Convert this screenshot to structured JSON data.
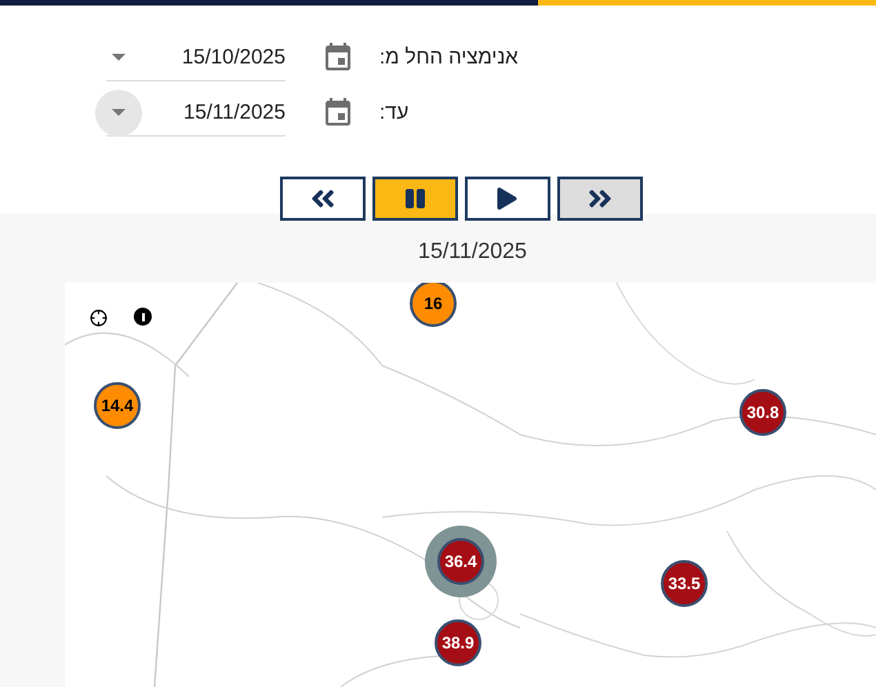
{
  "date_range": [
    {
      "label": "אנימציה החל מ:",
      "value": "15/10/2025",
      "highlighted": false
    },
    {
      "label": "עד:",
      "value": "15/11/2025",
      "highlighted": true
    }
  ],
  "playback_buttons": [
    {
      "kind": "rewind",
      "active": false,
      "pressed": false
    },
    {
      "kind": "pause",
      "active": true,
      "pressed": false
    },
    {
      "kind": "play",
      "active": false,
      "pressed": false
    },
    {
      "kind": "forward",
      "active": false,
      "pressed": true
    }
  ],
  "current_date": "15/11/2025",
  "map": {
    "markers": [
      {
        "value": "16",
        "color": "#ff8c00",
        "selected": false
      },
      {
        "value": "14.4",
        "color": "#ff8c00",
        "selected": false
      },
      {
        "value": "30.8",
        "color": "#a50e15",
        "selected": false
      },
      {
        "value": "36.4",
        "color": "#a50e15",
        "selected": true
      },
      {
        "value": "38.9",
        "color": "#a50e15",
        "selected": false
      },
      {
        "value": "33.5",
        "color": "#a50e15",
        "selected": false
      }
    ]
  }
}
